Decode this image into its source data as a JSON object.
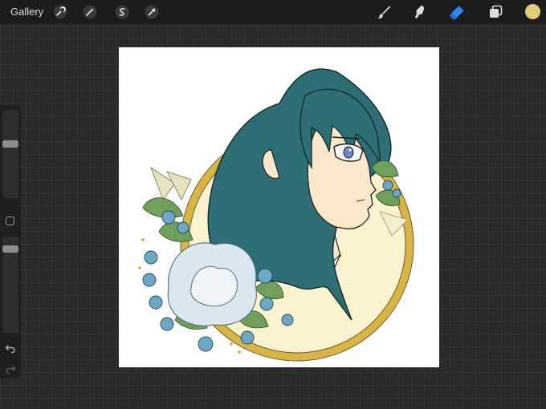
{
  "topbar": {
    "gallery_label": "Gallery",
    "left_tools": [
      {
        "icon": "wrench-icon",
        "name": "actions"
      },
      {
        "icon": "magic-wand-icon",
        "name": "adjustments"
      },
      {
        "icon": "selection-icon",
        "name": "selection"
      },
      {
        "icon": "transform-arrow-icon",
        "name": "transform"
      }
    ],
    "right_tools": [
      {
        "icon": "brush-icon",
        "name": "brush",
        "active": false
      },
      {
        "icon": "smudge-icon",
        "name": "smudge",
        "active": false
      },
      {
        "icon": "eraser-icon",
        "name": "eraser",
        "active": true
      },
      {
        "icon": "layers-icon",
        "name": "layers",
        "active": false
      }
    ],
    "current_color": "#e2cc77"
  },
  "sidebar": {
    "brush_size_level": 0.38,
    "opacity_level": 0.1,
    "icons": [
      "modify-square-icon",
      "undo-icon",
      "redo-icon"
    ]
  },
  "colors": {
    "accent": "#2f86f7",
    "hair": "#2f6e74",
    "skin": "#fbe8cc",
    "frame_gold": "#d8b545",
    "frame_fill": "#fbf3d0",
    "flower": "#6ea7c4",
    "leaf": "#6ea05c"
  }
}
